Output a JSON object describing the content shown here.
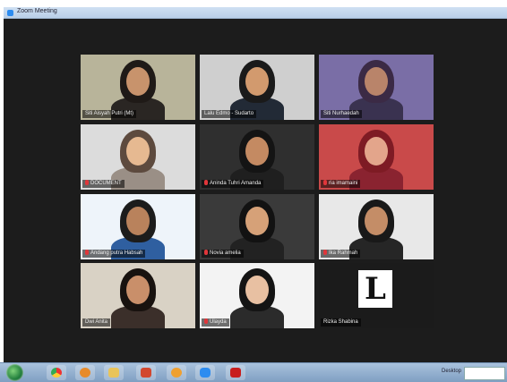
{
  "window": {
    "title": "Zoom Meeting"
  },
  "participants": [
    {
      "name": "Siti Aisyah Putri (Mt)",
      "muted": false,
      "bg": "#b8b49a",
      "skin": "#c8936c",
      "hair": "#1f1a17",
      "shirt": "#2a2623",
      "active": false
    },
    {
      "name": "Lalu Edmo - Sudarto",
      "muted": false,
      "bg": "#cfcfcf",
      "skin": "#d29a6e",
      "hair": "#1a1a1a",
      "shirt": "#222a36",
      "active": true
    },
    {
      "name": "Siti Nurhaedah",
      "muted": false,
      "bg": "#7a6ea6",
      "skin": "#b9846a",
      "hair": "#3b2a45",
      "shirt": "#3a3250",
      "active": false
    },
    {
      "name": "DOCUMENT",
      "muted": true,
      "bg": "#dcdcdc",
      "skin": "#e6b991",
      "hair": "#5d4a3e",
      "shirt": "#9a8f86",
      "active": false
    },
    {
      "name": "Aninda Tuhri Amanda",
      "muted": true,
      "bg": "#2f2f2f",
      "skin": "#c48a62",
      "hair": "#141414",
      "shirt": "#1f1f1f",
      "active": false
    },
    {
      "name": "ria imamaini",
      "muted": true,
      "bg": "#c94a4a",
      "skin": "#e3a58b",
      "hair": "#7e1b24",
      "shirt": "#8a2330",
      "active": false
    },
    {
      "name": "Andang putra Habsah",
      "muted": true,
      "bg": "#eef4fa",
      "skin": "#b9825c",
      "hair": "#1c1c1c",
      "shirt": "#2f5fa0",
      "active": false
    },
    {
      "name": "Novia amelia",
      "muted": true,
      "bg": "#3a3a3a",
      "skin": "#d6a178",
      "hair": "#121212",
      "shirt": "#222",
      "active": false
    },
    {
      "name": "Ika Rahmah",
      "muted": true,
      "bg": "#e8e8e8",
      "skin": "#c48d67",
      "hair": "#191919",
      "shirt": "#262626",
      "active": false
    },
    {
      "name": "Dwi Anita",
      "muted": false,
      "bg": "#d9d2c5",
      "skin": "#c98f6a",
      "hair": "#18120f",
      "shirt": "#3b2f2a",
      "active": false
    },
    {
      "name": "Ulayda",
      "muted": true,
      "bg": "#f3f3f3",
      "skin": "#e8c0a2",
      "hair": "#141414",
      "shirt": "#2b2b2b",
      "active": false
    },
    {
      "name": "Rizka Shabina",
      "muted": false,
      "bg": "#1b1b1b",
      "skin": "",
      "hair": "",
      "shirt": "",
      "active": false,
      "logo_letter": "L"
    }
  ],
  "taskbar": {
    "tray_label": "Desktop"
  }
}
